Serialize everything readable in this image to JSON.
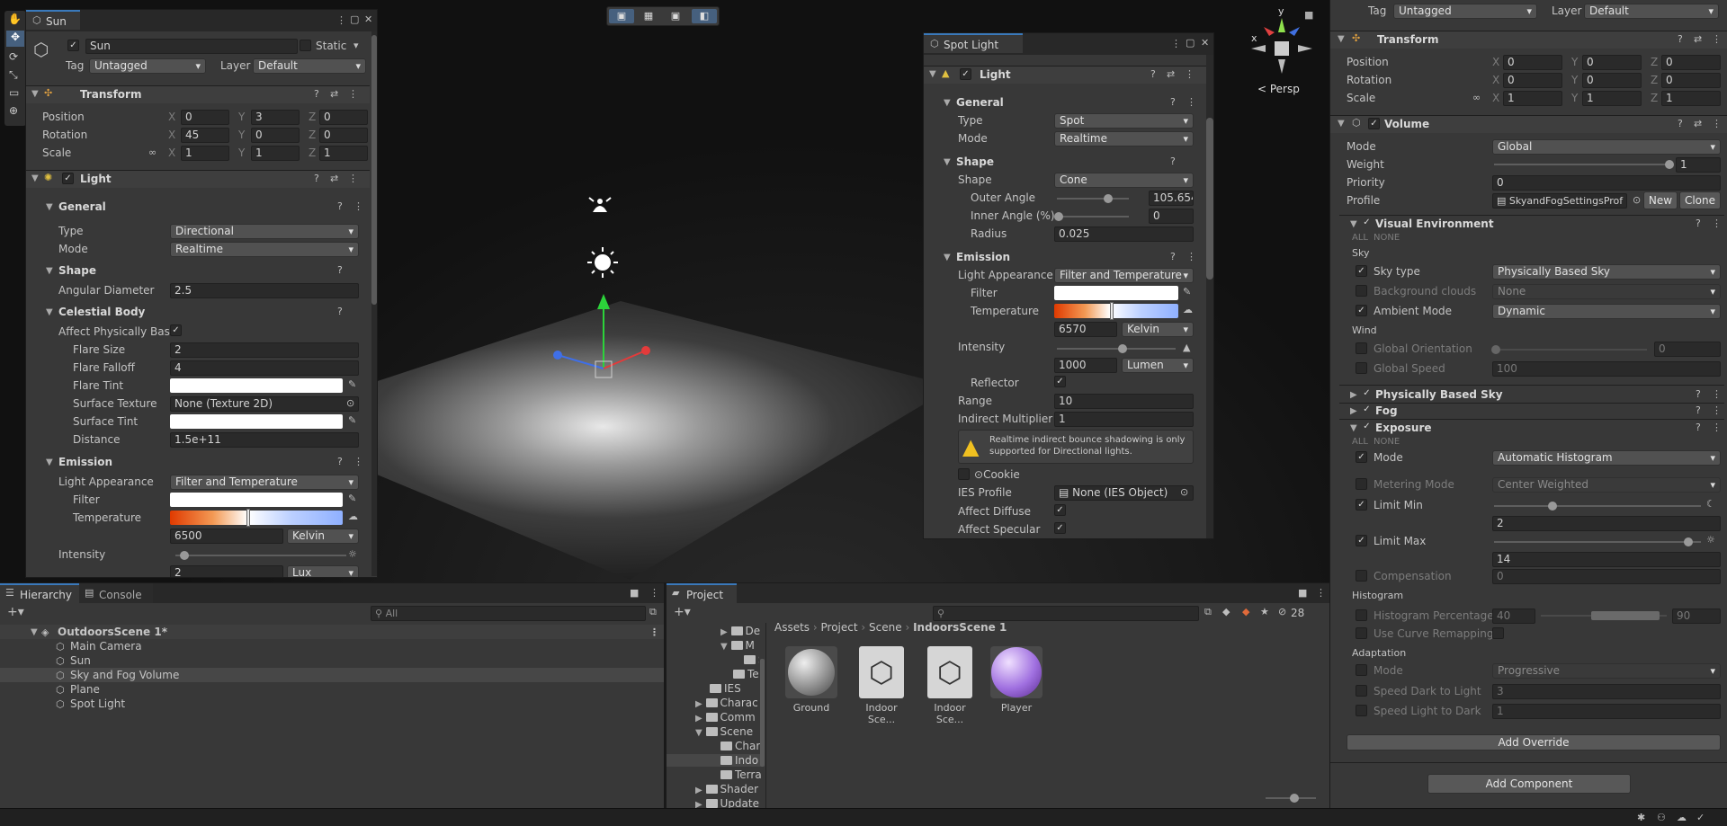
{
  "sun_inspector": {
    "title": "Sun",
    "object_name": "Sun",
    "static_label": "Static",
    "tag_label": "Tag",
    "tag_value": "Untagged",
    "layer_label": "Layer",
    "layer_value": "Default",
    "transform": {
      "title": "Transform",
      "position_label": "Position",
      "rotation_label": "Rotation",
      "scale_label": "Scale",
      "px": "0",
      "py": "3",
      "pz": "0",
      "rx": "45",
      "ry": "0",
      "rz": "0",
      "sx": "1",
      "sy": "1",
      "sz": "1"
    },
    "light": {
      "title": "Light",
      "general": "General",
      "type_label": "Type",
      "type_value": "Directional",
      "mode_label": "Mode",
      "mode_value": "Realtime",
      "shape": "Shape",
      "angular_label": "Angular Diameter",
      "angular_value": "2.5",
      "celestial": "Celestial Body",
      "affect_label": "Affect Physically Bas",
      "flare_size_label": "Flare Size",
      "flare_size": "2",
      "flare_falloff_label": "Flare Falloff",
      "flare_falloff": "4",
      "flare_tint_label": "Flare Tint",
      "surface_texture_label": "Surface Texture",
      "surface_texture": "None (Texture 2D)",
      "surface_tint_label": "Surface Tint",
      "distance_label": "Distance",
      "distance": "1.5e+11",
      "emission": "Emission",
      "appearance_label": "Light Appearance",
      "appearance_value": "Filter and Temperature",
      "filter_label": "Filter",
      "temperature_label": "Temperature",
      "temperature_value": "6500",
      "temperature_unit": "Kelvin",
      "intensity_label": "Intensity",
      "intensity_value": "2",
      "intensity_unit": "Lux"
    }
  },
  "spot_inspector": {
    "title": "Spot Light",
    "light_title": "Light",
    "general": "General",
    "type_label": "Type",
    "type_value": "Spot",
    "mode_label": "Mode",
    "mode_value": "Realtime",
    "shape": "Shape",
    "shape_label": "Shape",
    "shape_value": "Cone",
    "outer_label": "Outer Angle",
    "outer_value": "105.654",
    "inner_label": "Inner Angle (%)",
    "inner_value": "0",
    "radius_label": "Radius",
    "radius_value": "0.025",
    "emission": "Emission",
    "appearance_label": "Light Appearance",
    "appearance_value": "Filter and Temperature",
    "filter_label": "Filter",
    "temperature_label": "Temperature",
    "temperature_value": "6570",
    "temperature_unit": "Kelvin",
    "intensity_label": "Intensity",
    "intensity_value": "1000",
    "intensity_unit": "Lumen",
    "reflector_label": "Reflector",
    "range_label": "Range",
    "range_value": "10",
    "indirect_label": "Indirect Multiplier",
    "indirect_value": "1",
    "warning": "Realtime indirect bounce shadowing is only supported for Directional lights.",
    "cookie_label": "Cookie",
    "ies_label": "IES Profile",
    "ies_value": "None (IES Object)",
    "diffuse_label": "Affect Diffuse",
    "specular_label": "Affect Specular"
  },
  "scene": {
    "persp_label": "< Persp",
    "gizmo_x": "x",
    "gizmo_y": "y"
  },
  "volume_inspector": {
    "tag_label": "Tag",
    "tag_value": "Untagged",
    "layer_label": "Layer",
    "layer_value": "Default",
    "transform": "Transform",
    "position_label": "Position",
    "rotation_label": "Rotation",
    "scale_label": "Scale",
    "px": "0",
    "py": "0",
    "pz": "0",
    "rx": "0",
    "ry": "0",
    "rz": "0",
    "sx": "1",
    "sy": "1",
    "sz": "1",
    "volume": "Volume",
    "mode_label": "Mode",
    "mode_value": "Global",
    "weight_label": "Weight",
    "weight_value": "1",
    "priority_label": "Priority",
    "priority_value": "0",
    "profile_label": "Profile",
    "profile_value": "SkyandFogSettingsProf",
    "new_label": "New",
    "clone_label": "Clone",
    "visual_env": "Visual Environment",
    "all": "ALL",
    "none": "NONE",
    "sky_label": "Sky",
    "sky_type_label": "Sky type",
    "sky_type_value": "Physically Based Sky",
    "bg_clouds_label": "Background clouds",
    "bg_clouds_value": "None",
    "ambient_label": "Ambient Mode",
    "ambient_value": "Dynamic",
    "wind_label": "Wind",
    "global_orient_label": "Global Orientation",
    "global_orient_value": "0",
    "global_speed_label": "Global Speed",
    "global_speed_value": "100",
    "pbs": "Physically Based Sky",
    "fog": "Fog",
    "exposure": "Exposure",
    "exp_mode_label": "Mode",
    "exp_mode_value": "Automatic Histogram",
    "metering_label": "Metering Mode",
    "metering_value": "Center Weighted",
    "limit_min_label": "Limit Min",
    "limit_min_value": "2",
    "limit_max_label": "Limit Max",
    "limit_max_value": "14",
    "compensation_label": "Compensation",
    "compensation_value": "0",
    "histogram_label": "Histogram",
    "hist_pct_label": "Histogram Percentages",
    "hist_pct_min": "40",
    "hist_pct_max": "90",
    "curve_label": "Use Curve Remapping",
    "adaptation_label": "Adaptation",
    "adapt_mode_label": "Mode",
    "adapt_mode_value": "Progressive",
    "dark_light_label": "Speed Dark to Light",
    "dark_light_value": "3",
    "light_dark_label": "Speed Light to Dark",
    "light_dark_value": "1",
    "add_override": "Add Override",
    "add_component": "Add Component"
  },
  "hierarchy": {
    "tab": "Hierarchy",
    "console_tab": "Console",
    "search_placeholder": "All",
    "scene": "OutdoorsScene 1*",
    "items": [
      "Main Camera",
      "Sun",
      "Sky and Fog Volume",
      "Plane",
      "Spot Light"
    ]
  },
  "project": {
    "tab": "Project",
    "count": "28",
    "tree": [
      "De",
      "M",
      "Sun",
      "Te",
      "IES",
      "Charac",
      "Comm",
      "Scene",
      "Char",
      "Indo",
      "Terra",
      "Shader",
      "Update"
    ],
    "breadcrumb": [
      "Assets",
      "Project",
      "Scene",
      "IndoorsScene 1"
    ],
    "assets": [
      "Ground",
      "Indoor Sce...",
      "Indoor Sce...",
      "Player"
    ]
  },
  "colors": {
    "accent": "#3a79bb",
    "panel": "#383838",
    "field": "#2a2a2a"
  }
}
